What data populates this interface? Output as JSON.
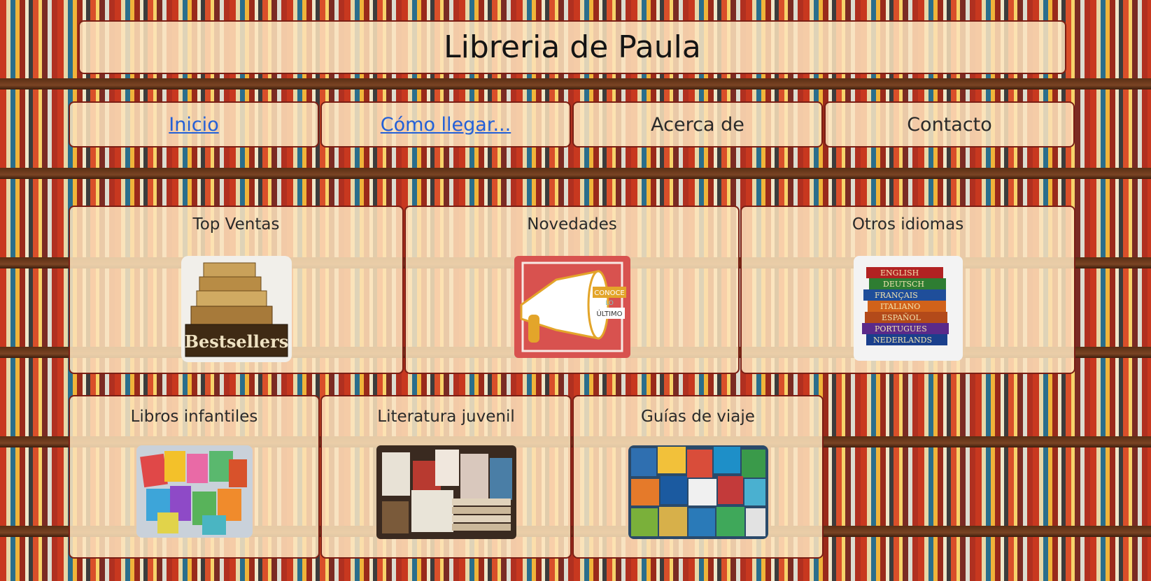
{
  "site": {
    "title": "Libreria de Paula"
  },
  "nav": [
    {
      "label": "Inicio",
      "link": true
    },
    {
      "label": "Cómo llegar...",
      "link": true
    },
    {
      "label": "Acerca de",
      "link": false
    },
    {
      "label": "Contacto",
      "link": false
    }
  ],
  "categories": [
    {
      "title": "Top Ventas",
      "image_text": "Bestsellers"
    },
    {
      "title": "Novedades",
      "image_text": [
        "CONOCE",
        "LO",
        "ÚLTIMO"
      ]
    },
    {
      "title": "Otros idiomas",
      "image_text": [
        "ENGLISH",
        "DEUTSCH",
        "FRANÇAIS",
        "ITALIANO",
        "ESPAÑOL",
        "PORTUGUES",
        "NEDERLANDS"
      ]
    },
    {
      "title": "Libros infantiles"
    },
    {
      "title": "Literatura juvenil"
    },
    {
      "title": "Guías de viaje"
    }
  ],
  "colors": {
    "panel_bg": "#fde4be",
    "panel_border": "#7a1e14",
    "link": "#2360d8"
  }
}
